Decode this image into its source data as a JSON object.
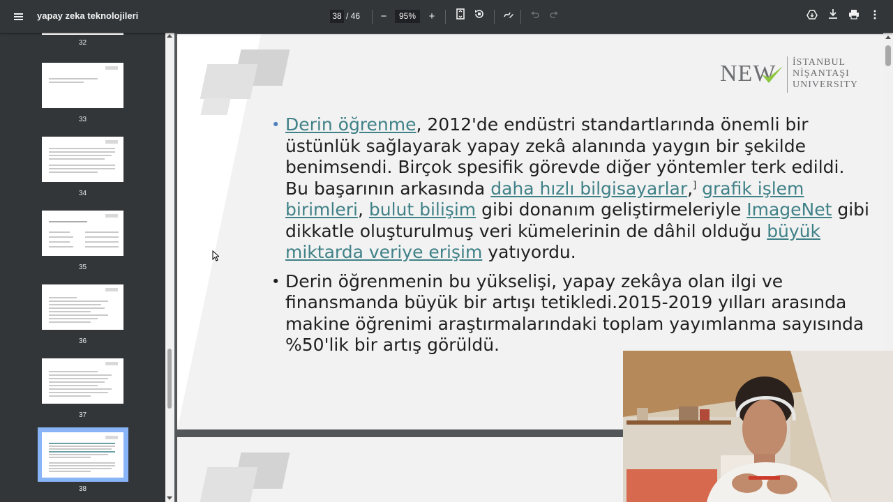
{
  "toolbar": {
    "title": "yapay zeka teknolojileri",
    "current_page": "38",
    "total_pages": "/ 46",
    "zoom": "95%",
    "zoom_out_label": "−",
    "zoom_in_label": "+",
    "icons": [
      "menu-icon",
      "fit-page-icon",
      "rotate-icon",
      "annotate-icon",
      "undo-icon",
      "redo-icon",
      "drive-icon",
      "download-icon",
      "print-icon",
      "more-icon"
    ]
  },
  "sidebar": {
    "thumbnails": [
      {
        "num": "32"
      },
      {
        "num": "33"
      },
      {
        "num": "34"
      },
      {
        "num": "35"
      },
      {
        "num": "36"
      },
      {
        "num": "37"
      },
      {
        "num": "38",
        "selected": true
      }
    ]
  },
  "slide": {
    "logo": {
      "new": "NEW",
      "line1": "İSTANBUL",
      "line2": "NİŞANTAŞI",
      "line3": "UNIVERSITY"
    },
    "bullet1": {
      "link1": "Derin öğrenme",
      "t1": ", 2012'de endüstri standartlarında önemli bir üstünlük sağlayarak yapay zekâ alanında yaygın bir şekilde benimsendi. Birçok spesifik görevde diğer yöntemler terk edildi. Bu başarının arkasında ",
      "link2": "daha hızlı bilgisayarlar",
      "t2": ",",
      "sup": "]",
      "t3": " ",
      "link3": "grafik işlem birimleri",
      "t4": ", ",
      "link4": "bulut bilişim",
      "t5": " gibi donanım geliştirmeleriyle ",
      "link5": "ImageNet",
      "t6": " gibi dikkatle oluşturulmuş veri kümelerinin de dâhil olduğu ",
      "link6": "büyük miktarda veriye erişim",
      "t7": " yatıyordu."
    },
    "bullet2": {
      "text": "Derin öğrenmenin bu yükselişi, yapay zekâya olan ilgi ve finansmanda büyük bir artışı tetikledi.2015-2019 yılları arasında makine öğrenimi araştırmalarındaki toplam yayımlanma sayısında %50'lik bir artış görüldü."
    }
  },
  "colors": {
    "toolbar_bg": "#323639",
    "link": "#3f8187",
    "selected_thumb": "#8ab4f8",
    "logo_green": "#8dc63f"
  }
}
